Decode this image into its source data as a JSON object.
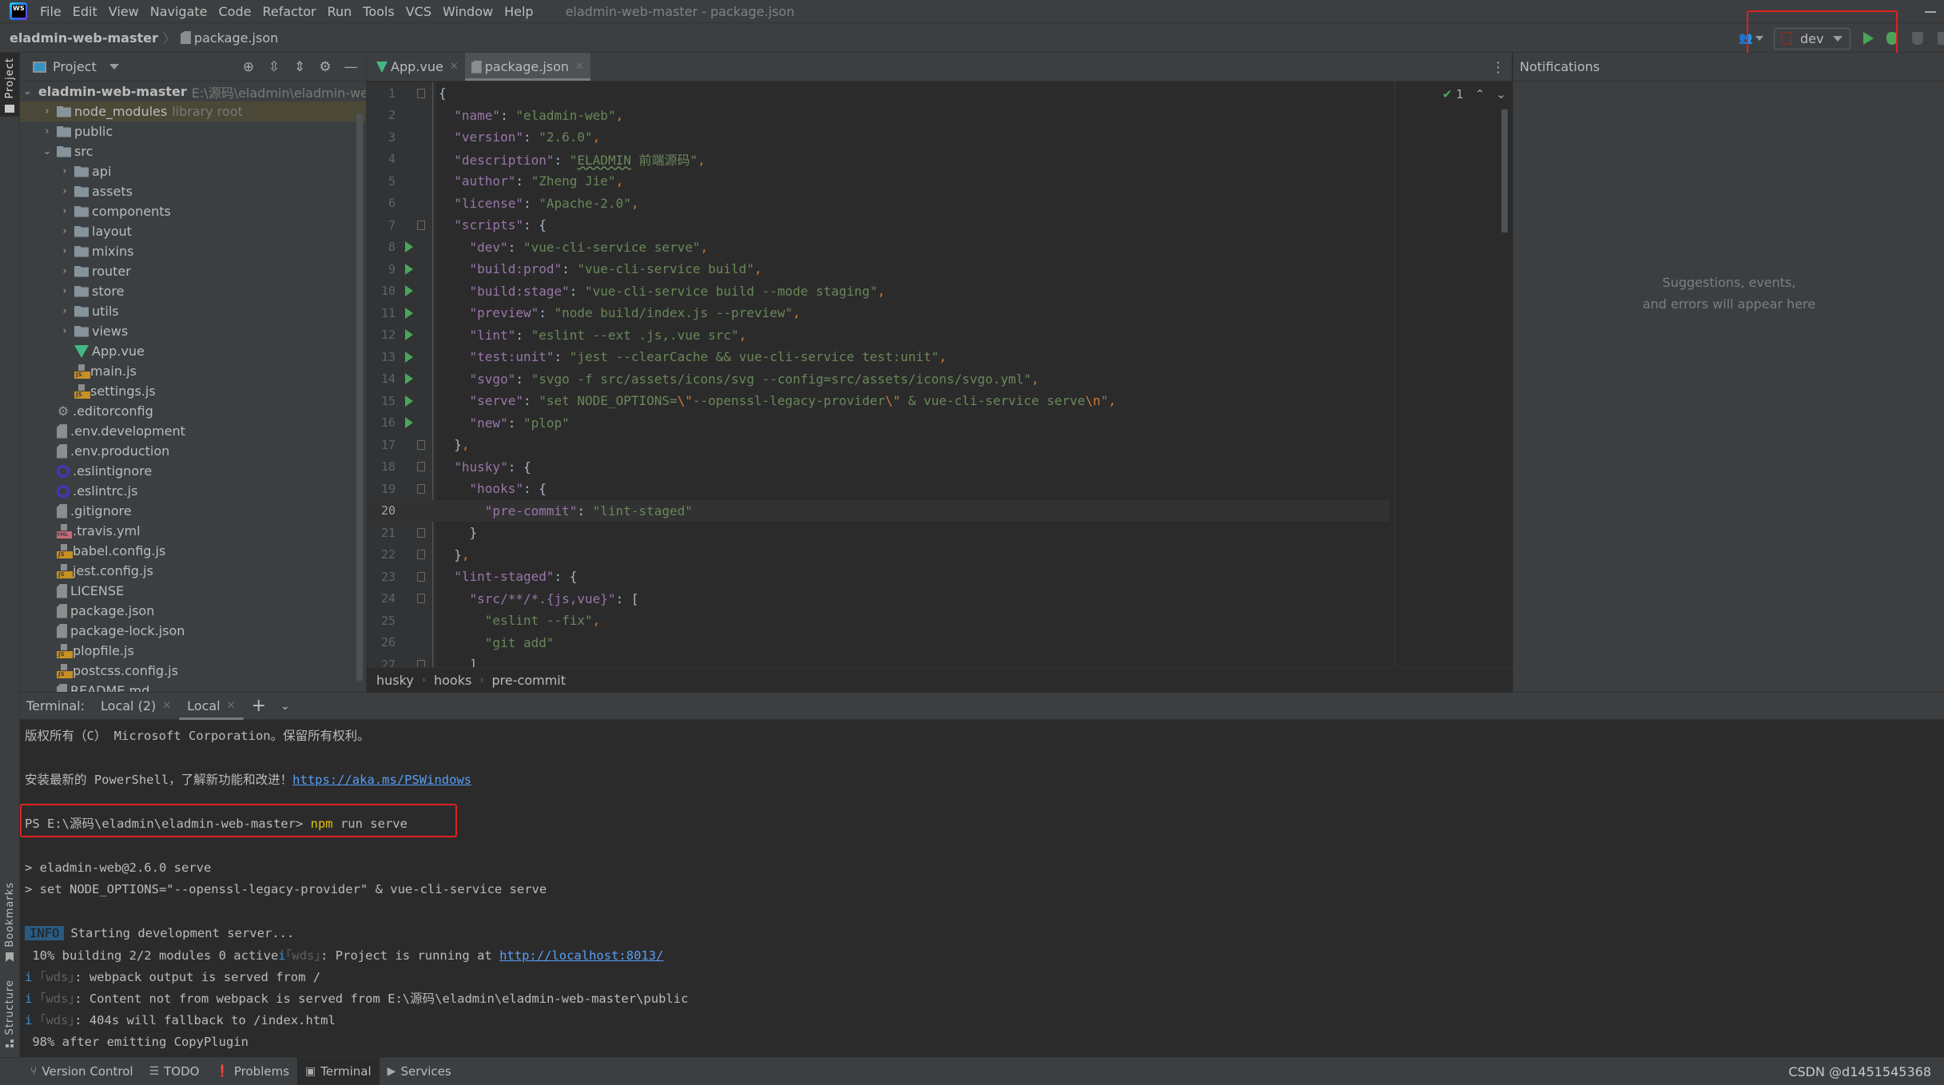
{
  "window": {
    "title": "eladmin-web-master - package.json",
    "menu": [
      "File",
      "Edit",
      "View",
      "Navigate",
      "Code",
      "Refactor",
      "Run",
      "Tools",
      "VCS",
      "Window",
      "Help"
    ]
  },
  "navbar": {
    "project": "eladmin-web-master",
    "file": "package.json",
    "run_config": "dev"
  },
  "left_stripe": {
    "project": "Project",
    "bookmarks": "Bookmarks",
    "structure": "Structure"
  },
  "project_panel": {
    "title": "Project",
    "root": {
      "name": "eladmin-web-master",
      "path": "E:\\源码\\eladmin\\eladmin-web"
    },
    "items": [
      {
        "name": "node_modules",
        "hint": "library root",
        "type": "folder",
        "depth": 1,
        "expanded": false
      },
      {
        "name": "public",
        "type": "folder",
        "depth": 1,
        "expanded": false
      },
      {
        "name": "src",
        "type": "folder",
        "depth": 1,
        "expanded": true
      },
      {
        "name": "api",
        "type": "folder",
        "depth": 2,
        "expanded": false
      },
      {
        "name": "assets",
        "type": "folder",
        "depth": 2,
        "expanded": false
      },
      {
        "name": "components",
        "type": "folder",
        "depth": 2,
        "expanded": false
      },
      {
        "name": "layout",
        "type": "folder",
        "depth": 2,
        "expanded": false
      },
      {
        "name": "mixins",
        "type": "folder",
        "depth": 2,
        "expanded": false
      },
      {
        "name": "router",
        "type": "folder",
        "depth": 2,
        "expanded": false
      },
      {
        "name": "store",
        "type": "folder",
        "depth": 2,
        "expanded": false
      },
      {
        "name": "utils",
        "type": "folder",
        "depth": 2,
        "expanded": false
      },
      {
        "name": "views",
        "type": "folder",
        "depth": 2,
        "expanded": false
      },
      {
        "name": "App.vue",
        "type": "vue",
        "depth": 2
      },
      {
        "name": "main.js",
        "type": "js",
        "depth": 2
      },
      {
        "name": "settings.js",
        "type": "js",
        "depth": 2
      },
      {
        "name": ".editorconfig",
        "type": "gear",
        "depth": 1
      },
      {
        "name": ".env.development",
        "type": "text",
        "depth": 1
      },
      {
        "name": ".env.production",
        "type": "text",
        "depth": 1
      },
      {
        "name": ".eslintignore",
        "type": "eslint",
        "depth": 1
      },
      {
        "name": ".eslintrc.js",
        "type": "eslint",
        "depth": 1
      },
      {
        "name": ".gitignore",
        "type": "gitignore",
        "depth": 1
      },
      {
        "name": ".travis.yml",
        "type": "yml",
        "depth": 1
      },
      {
        "name": "babel.config.js",
        "type": "js",
        "depth": 1
      },
      {
        "name": "jest.config.js",
        "type": "js",
        "depth": 1
      },
      {
        "name": "LICENSE",
        "type": "text",
        "depth": 1
      },
      {
        "name": "package.json",
        "type": "json",
        "depth": 1
      },
      {
        "name": "package-lock.json",
        "type": "json",
        "depth": 1
      },
      {
        "name": "plopfile.js",
        "type": "js",
        "depth": 1
      },
      {
        "name": "postcss.config.js",
        "type": "js",
        "depth": 1
      },
      {
        "name": "README.md",
        "type": "text",
        "depth": 1
      }
    ]
  },
  "editor": {
    "tabs": [
      {
        "label": "App.vue",
        "icon": "vue-icon",
        "active": false
      },
      {
        "label": "package.json",
        "icon": "json-file-icon",
        "active": true
      }
    ],
    "inspection_count": "1",
    "current_line": 20,
    "lines": [
      {
        "n": 1,
        "fold": true,
        "html": "{"
      },
      {
        "n": 2,
        "html": "  <span class=\"k\">\"name\"</span>: <span class=\"s\">\"eladmin-web\"</span><span class=\"p\">,</span>"
      },
      {
        "n": 3,
        "html": "  <span class=\"k\">\"version\"</span>: <span class=\"s\">\"2.6.0\"</span><span class=\"p\">,</span>"
      },
      {
        "n": 4,
        "html": "  <span class=\"k\">\"description\"</span>: <span class=\"s\">\"<span class=\"wavy\">ELADMIN</span> 前端源码\"</span><span class=\"p\">,</span>"
      },
      {
        "n": 5,
        "html": "  <span class=\"k\">\"author\"</span>: <span class=\"s\">\"Zheng Jie\"</span><span class=\"p\">,</span>"
      },
      {
        "n": 6,
        "html": "  <span class=\"k\">\"license\"</span>: <span class=\"s\">\"Apache-2.0\"</span><span class=\"p\">,</span>"
      },
      {
        "n": 7,
        "fold": true,
        "html": "  <span class=\"k\">\"scripts\"</span>: {"
      },
      {
        "n": 8,
        "run": true,
        "html": "    <span class=\"k\">\"dev\"</span>: <span class=\"s\">\"vue-cli-service serve\"</span><span class=\"p\">,</span>"
      },
      {
        "n": 9,
        "run": true,
        "html": "    <span class=\"k\">\"build:prod\"</span>: <span class=\"s\">\"vue-cli-service build\"</span><span class=\"p\">,</span>"
      },
      {
        "n": 10,
        "run": true,
        "html": "    <span class=\"k\">\"build:stage\"</span>: <span class=\"s\">\"vue-cli-service build --mode staging\"</span><span class=\"p\">,</span>"
      },
      {
        "n": 11,
        "run": true,
        "html": "    <span class=\"k\">\"preview\"</span>: <span class=\"s\">\"node build/index.js --preview\"</span><span class=\"p\">,</span>"
      },
      {
        "n": 12,
        "run": true,
        "html": "    <span class=\"k\">\"lint\"</span>: <span class=\"s\">\"eslint --ext .js,.vue src\"</span><span class=\"p\">,</span>"
      },
      {
        "n": 13,
        "run": true,
        "html": "    <span class=\"k\">\"test:unit\"</span>: <span class=\"s\">\"jest --clearCache &amp;&amp; vue-cli-service test:unit\"</span><span class=\"p\">,</span>"
      },
      {
        "n": 14,
        "run": true,
        "html": "    <span class=\"k\">\"svgo\"</span>: <span class=\"s\">\"svgo -f src/assets/icons/svg --config=src/assets/icons/svgo.yml\"</span><span class=\"p\">,</span>"
      },
      {
        "n": 15,
        "run": true,
        "html": "    <span class=\"k\">\"serve\"</span>: <span class=\"s\">\"set NODE_OPTIONS=<span class=\"esc\">\\\"</span>--openssl-legacy-provider<span class=\"esc\">\\\"</span> &amp; vue-cli-service serve<span class=\"esc\">\\n</span>\"</span><span class=\"p\">,</span>"
      },
      {
        "n": 16,
        "run": true,
        "html": "    <span class=\"k\">\"new\"</span>: <span class=\"s\">\"plop\"</span>"
      },
      {
        "n": 17,
        "fold": true,
        "html": "  }<span class=\"p\">,</span>"
      },
      {
        "n": 18,
        "fold": true,
        "html": "  <span class=\"k\">\"husky\"</span>: {"
      },
      {
        "n": 19,
        "fold": true,
        "html": "    <span class=\"k\">\"hooks\"</span>: {"
      },
      {
        "n": 20,
        "html": "      <span class=\"k\">\"pre-commit\"</span>: <span class=\"s\">\"lint-staged\"</span>"
      },
      {
        "n": 21,
        "fold": true,
        "html": "    }"
      },
      {
        "n": 22,
        "fold": true,
        "html": "  }<span class=\"p\">,</span>"
      },
      {
        "n": 23,
        "fold": true,
        "html": "  <span class=\"k\">\"lint-staged\"</span>: {"
      },
      {
        "n": 24,
        "fold": true,
        "html": "    <span class=\"k\">\"src/**/*.{js,vue}\"</span>: ["
      },
      {
        "n": 25,
        "html": "      <span class=\"s\">\"eslint --fix\"</span><span class=\"p\">,</span>"
      },
      {
        "n": 26,
        "html": "      <span class=\"s\">\"git add\"</span>"
      },
      {
        "n": 27,
        "fold": true,
        "html": "    ]"
      }
    ],
    "breadcrumb": [
      "husky",
      "hooks",
      "pre-commit"
    ]
  },
  "notifications": {
    "title": "Notifications",
    "empty_line1": "Suggestions, events,",
    "empty_line2": "and errors will appear here"
  },
  "terminal": {
    "label": "Terminal:",
    "tabs": [
      {
        "label": "Local (2)",
        "active": false
      },
      {
        "label": "Local",
        "active": true
      }
    ],
    "lines": {
      "copyright": "版权所有（C） Microsoft Corporation。保留所有权利。",
      "install_prefix": "安装最新的 PowerShell，了解新功能和改进！",
      "install_link": "https://aka.ms/PSWindows",
      "prompt": "PS E:\\源码\\eladmin\\eladmin-web-master> ",
      "command_npm": "npm",
      "command_rest": " run serve",
      "script_name": "> eladmin-web@2.6.0 serve",
      "script_cmd": "> set NODE_OPTIONS=\"--openssl-legacy-provider\" & vue-cli-service serve",
      "info_badge": "INFO",
      "info_text": "Starting development server...",
      "building_prefix": " 10% building 2/2 modules 0 active",
      "running_text": ": Project is running at ",
      "running_link": "http://localhost:8013/",
      "wds1": ": webpack output is served from /",
      "wds2": ": Content not from webpack is served from E:\\源码\\eladmin\\eladmin-web-master\\public",
      "wds3": ": 404s will fallback to /index.html",
      "emitting": " 98% after emitting CopyPlugin",
      "wds_tag": "｢wds｣"
    }
  },
  "statusbar": {
    "tools": [
      {
        "label": "Version Control",
        "icon": "version-control-icon",
        "active": false
      },
      {
        "label": "TODO",
        "icon": "todo-icon",
        "active": false
      },
      {
        "label": "Problems",
        "icon": "problems-icon",
        "active": false
      },
      {
        "label": "Terminal",
        "icon": "terminal-icon",
        "active": true
      },
      {
        "label": "Services",
        "icon": "services-icon",
        "active": false
      }
    ],
    "watermark": "CSDN @d1451545368"
  }
}
